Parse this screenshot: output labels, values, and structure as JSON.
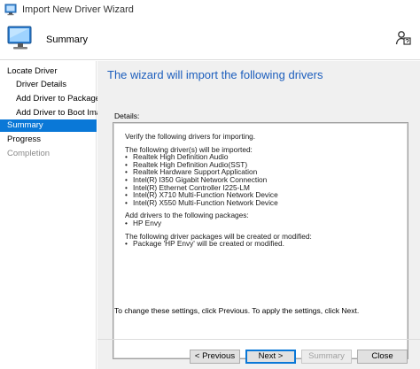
{
  "window": {
    "title": "Import New Driver Wizard"
  },
  "header": {
    "title": "Summary",
    "icon": "computer-monitor-icon",
    "help_icon": "person-help-icon"
  },
  "sidebar": {
    "items": [
      {
        "label": "Locate Driver",
        "level": 0,
        "state": "normal"
      },
      {
        "label": "Driver Details",
        "level": 1,
        "state": "normal"
      },
      {
        "label": "Add Driver to Packages",
        "level": 1,
        "state": "normal"
      },
      {
        "label": "Add Driver to Boot Images",
        "level": 1,
        "state": "normal"
      },
      {
        "label": "Summary",
        "level": 0,
        "state": "active"
      },
      {
        "label": "Progress",
        "level": 0,
        "state": "normal"
      },
      {
        "label": "Completion",
        "level": 0,
        "state": "disabled"
      }
    ]
  },
  "main": {
    "heading": "The wizard will import the following drivers",
    "details_label": "Details:",
    "details": {
      "intro": "Verify the following drivers for importing.",
      "drivers_header": "The following driver(s) will be imported:",
      "drivers": [
        "Realtek High Definition Audio",
        "Realtek High Definition Audio(SST)",
        "Realtek Hardware Support Application",
        "Intel(R) I350 Gigabit Network Connection",
        "Intel(R) Ethernet Controller I225-LM",
        "Intel(R) X710 Multi-Function Network Device",
        "Intel(R) X550 Multi-Function Network Device"
      ],
      "packages_header": "Add drivers to the following packages:",
      "packages": [
        "HP Envy"
      ],
      "created_header": "The following driver packages will be created or modified:",
      "created": [
        "Package 'HP Envy' will be created or modified."
      ]
    },
    "footer_note": "To change these settings, click Previous. To apply the settings, click Next."
  },
  "buttons": {
    "previous": "< Previous",
    "next": "Next >",
    "summary": "Summary",
    "close": "Close"
  },
  "colors": {
    "accent": "#0a78d7",
    "heading": "#1c5ebd",
    "content_bg": "#f0f0f0"
  }
}
